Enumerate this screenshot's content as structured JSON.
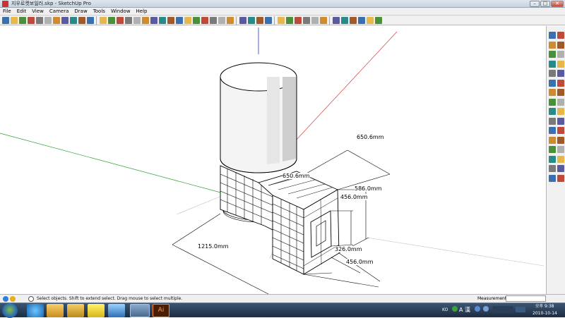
{
  "window": {
    "title": "지우로켓보일러.skp - SketchUp Pro"
  },
  "menu": [
    "File",
    "Edit",
    "View",
    "Camera",
    "Draw",
    "Tools",
    "Window",
    "Help"
  ],
  "colors": {
    "red_axis": "#d04040",
    "green_axis": "#2aa02a",
    "blue_axis": "#3030c0",
    "face": "#ffffff",
    "edge": "#000000"
  },
  "icons": {
    "toolbar": [
      "new-icon",
      "open-icon",
      "save-icon",
      "cut-icon",
      "copy-icon",
      "paste-icon",
      "erase-icon",
      "undo-icon",
      "redo-icon",
      "print-icon",
      "model-info-icon",
      "select-icon",
      "line-icon",
      "rectangle-icon",
      "circle-icon",
      "arc-icon",
      "polygon-icon",
      "freehand-icon",
      "eraser-icon",
      "tape-measure-icon",
      "paint-bucket-icon",
      "push-pull-icon",
      "move-icon",
      "rotate-icon",
      "follow-me-icon",
      "scale-icon",
      "offset-icon",
      "orbit-icon",
      "pan-icon",
      "zoom-icon",
      "zoom-extents-icon",
      "iso-view-icon",
      "top-view-icon",
      "front-view-icon",
      "right-view-icon",
      "back-view-icon",
      "left-view-icon",
      "xray-icon",
      "wireframe-icon",
      "hidden-line-icon",
      "shaded-icon",
      "textured-icon",
      "monochrome-icon"
    ],
    "palette": [
      "select-icon",
      "eraser-icon",
      "paint-bucket-icon",
      "rectangle-icon",
      "line-icon",
      "circle-icon",
      "arc-icon",
      "polygon-icon",
      "freehand-icon",
      "move-icon",
      "push-pull-icon",
      "rotate-icon",
      "follow-me-icon",
      "scale-icon",
      "offset-icon",
      "tape-measure-icon",
      "dimension-icon",
      "protractor-icon",
      "text-icon",
      "axes-icon",
      "3d-text-icon",
      "orbit-icon",
      "pan-icon",
      "zoom-icon",
      "zoom-window-icon",
      "previous-view-icon",
      "next-view-icon",
      "zoom-extents-icon",
      "position-camera-icon",
      "walk-icon",
      "look-around-icon",
      "section-plane-icon"
    ]
  },
  "dimensions": {
    "top_width": "650.6mm",
    "inner_width": "650.6mm",
    "outer_height": "586.0mm",
    "inner_height": "456.0mm",
    "length": "1215.0mm",
    "inner_depth": "326.0mm",
    "outer_depth": "456.0mm"
  },
  "status": {
    "hint": "Select objects. Shift to extend select. Drag mouse to select multiple.",
    "measurements_label": "Measurements",
    "measurements_value": ""
  },
  "taskbar": {
    "lang": "KO",
    "ampm": "오후",
    "time": "9:38",
    "date": "2010-10-14",
    "tasks": [
      "start-icon",
      "ie-icon",
      "explorer-icon",
      "folder-icon",
      "kakao-icon",
      "media-icon",
      "sketchup-icon",
      "illustrator-icon"
    ]
  }
}
